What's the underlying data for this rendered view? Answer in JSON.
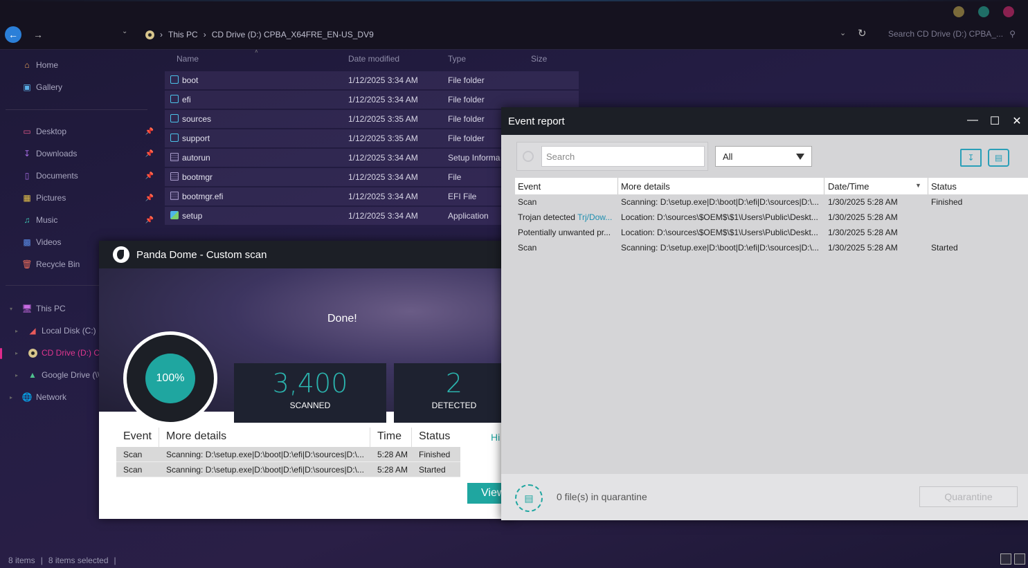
{
  "explorer": {
    "address": [
      "This PC",
      "CD Drive (D:) CPBA_X64FRE_EN-US_DV9"
    ],
    "search_placeholder": "Search CD Drive (D:) CPBA_...",
    "sidebar": {
      "top": [
        "Home",
        "Gallery"
      ],
      "pinned": [
        "Desktop",
        "Downloads",
        "Documents",
        "Pictures",
        "Music",
        "Videos",
        "Recycle Bin"
      ],
      "this_pc": "This PC",
      "drives": [
        "Local Disk (C:)",
        "CD Drive (D:) CI",
        "Google Drive (\\\\"
      ],
      "network": "Network"
    },
    "columns": [
      "Name",
      "Date modified",
      "Type",
      "Size"
    ],
    "files": [
      {
        "name": "boot",
        "date": "1/12/2025 3:34 AM",
        "type": "File folder",
        "icon": "folder-icon"
      },
      {
        "name": "efi",
        "date": "1/12/2025 3:34 AM",
        "type": "File folder",
        "icon": "folder-icon"
      },
      {
        "name": "sources",
        "date": "1/12/2025 3:35 AM",
        "type": "File folder",
        "icon": "folder-icon"
      },
      {
        "name": "support",
        "date": "1/12/2025 3:35 AM",
        "type": "File folder",
        "icon": "folder-icon"
      },
      {
        "name": "autorun",
        "date": "1/12/2025 3:34 AM",
        "type": "Setup Informa",
        "icon": "settings-file-icon"
      },
      {
        "name": "bootmgr",
        "date": "1/12/2025 3:34 AM",
        "type": "File",
        "icon": "file-icon"
      },
      {
        "name": "bootmgr.efi",
        "date": "1/12/2025 3:34 AM",
        "type": "EFI File",
        "icon": "file-icon"
      },
      {
        "name": "setup",
        "date": "1/12/2025 3:34 AM",
        "type": "Application",
        "icon": "app-icon"
      }
    ],
    "status": {
      "items": "8 items",
      "selected": "8 items selected"
    }
  },
  "panda": {
    "title": "Panda Dome - Custom scan",
    "done": "Done!",
    "progress": "100%",
    "progress_value": 1.0,
    "scanned_value": "3,400",
    "scanned_label": "SCANNED",
    "detected_value": "2",
    "detected_label": "DETECTED",
    "table_headers": [
      "Event",
      "More details",
      "Time",
      "Status"
    ],
    "rows": [
      {
        "event": "Scan",
        "details": "Scanning: D:\\setup.exe|D:\\boot|D:\\efi|D:\\sources|D:\\...",
        "time": "5:28 AM",
        "status": "Finished"
      },
      {
        "event": "Scan",
        "details": "Scanning: D:\\setup.exe|D:\\boot|D:\\efi|D:\\sources|D:\\...",
        "time": "5:28 AM",
        "status": "Started"
      }
    ],
    "hide_link": "Hi",
    "view_button": "View"
  },
  "event_report": {
    "title": "Event report",
    "search_placeholder": "Search",
    "filter": "All",
    "headers": [
      "Event",
      "More details",
      "Date/Time",
      "Status"
    ],
    "rows": [
      {
        "event": "Scan",
        "event_link": "",
        "details": "Scanning: D:\\setup.exe|D:\\boot|D:\\efi|D:\\sources|D:\\...",
        "datetime": "1/30/2025 5:28 AM",
        "status": "Finished"
      },
      {
        "event": "Trojan detected ",
        "event_link": "Trj/Dow...",
        "details": "Location: D:\\sources\\$OEM$\\$1\\Users\\Public\\Deskt...",
        "datetime": "1/30/2025 5:28 AM",
        "status": ""
      },
      {
        "event": "Potentially unwanted pr...",
        "event_link": "",
        "details": "Location: D:\\sources\\$OEM$\\$1\\Users\\Public\\Deskt...",
        "datetime": "1/30/2025 5:28 AM",
        "status": ""
      },
      {
        "event": "Scan",
        "event_link": "",
        "details": "Scanning: D:\\setup.exe|D:\\boot|D:\\efi|D:\\sources|D:\\...",
        "datetime": "1/30/2025 5:28 AM",
        "status": "Started"
      }
    ],
    "quarantine_text": "0 file(s) in quarantine",
    "quarantine_button": "Quarantine"
  },
  "colors": {
    "accent_teal": "#1fa6a0",
    "active_pink": "#e02a8c",
    "back_blue": "#2b7fd8"
  }
}
